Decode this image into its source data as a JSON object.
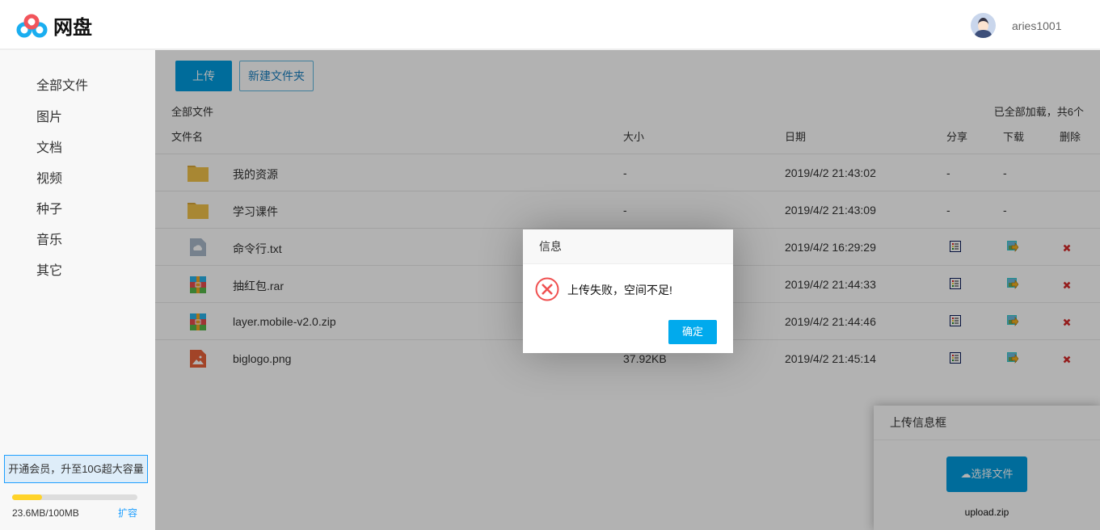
{
  "header": {
    "logo_text": "网盘",
    "username": "aries1001"
  },
  "sidebar": {
    "items": [
      {
        "label": "全部文件"
      },
      {
        "label": "图片"
      },
      {
        "label": "文档"
      },
      {
        "label": "视频"
      },
      {
        "label": "种子"
      },
      {
        "label": "音乐"
      },
      {
        "label": "其它"
      }
    ],
    "vip_label": "开通会员，升至10G超大容量",
    "quota_text": "23.6MB/100MB",
    "quota_used_fraction": 0.236,
    "expand_label": "扩容"
  },
  "toolbar": {
    "upload_label": "上传",
    "new_folder_label": "新建文件夹"
  },
  "list": {
    "breadcrumb": "全部文件",
    "loaded_text": "已全部加载，共6个",
    "columns": {
      "name": "文件名",
      "size": "大小",
      "date": "日期",
      "share": "分享",
      "download": "下载",
      "delete": "删除"
    },
    "rows": [
      {
        "name": "我的资源",
        "type": "folder",
        "size": "-",
        "date": "2019/4/2 21:43:02",
        "share": "-",
        "download": "-"
      },
      {
        "name": "学习课件",
        "type": "folder",
        "size": "-",
        "date": "2019/4/2 21:43:09",
        "share": "-",
        "download": "-"
      },
      {
        "name": "命令行.txt",
        "type": "txt",
        "size": "",
        "date": "2019/4/2 16:29:29"
      },
      {
        "name": "抽红包.rar",
        "type": "archive",
        "size": "",
        "date": "2019/4/2 21:44:33"
      },
      {
        "name": "layer.mobile-v2.0.zip",
        "type": "archive",
        "size": "",
        "date": "2019/4/2 21:44:46"
      },
      {
        "name": "biglogo.png",
        "type": "image",
        "size": "37.92KB",
        "date": "2019/4/2 21:45:14"
      }
    ]
  },
  "upload_box": {
    "title": "上传信息框",
    "choose_label": "选择文件",
    "file_name": "upload.zip"
  },
  "dialog": {
    "title": "信息",
    "message": "上传失败，空间不足!",
    "ok_label": "确定"
  },
  "colors": {
    "primary": "#009bde",
    "danger": "#e64a4a",
    "folder": "#f1c24a"
  }
}
